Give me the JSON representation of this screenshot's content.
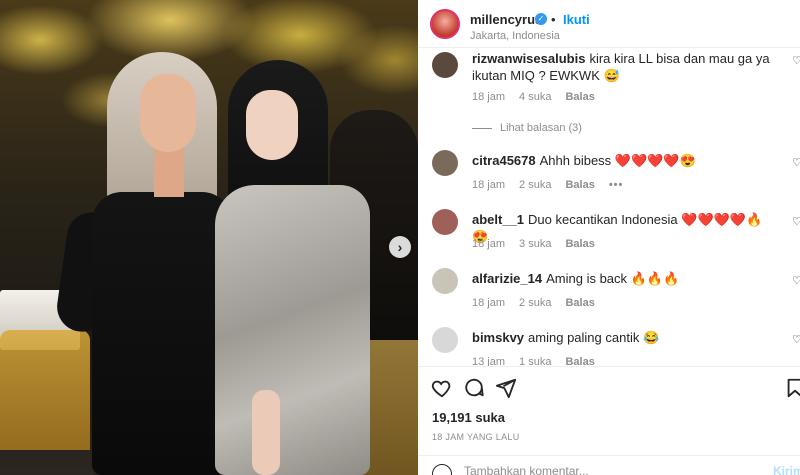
{
  "post": {
    "username": "millencyrus",
    "follow_label": "Ikuti",
    "dot": "•",
    "location": "Jakarta, Indonesia",
    "verified_icon": "verified-badge-icon",
    "next_icon": "chevron-right-icon"
  },
  "comments": [
    {
      "user": "rizwanwisesalubis",
      "text": "kira kira LL bisa dan mau ga ya ikutan MIQ ? EWKWK 😅",
      "time": "18 jam",
      "likes": "4 suka",
      "reply": "Balas",
      "avatar_color": "#5a4a3e"
    },
    {
      "user": "citra45678",
      "text": "Ahhh bibess ❤️❤️❤️❤️😍",
      "time": "18 jam",
      "likes": "2 suka",
      "reply": "Balas",
      "more": "•••",
      "avatar_color": "#7a6a5a"
    },
    {
      "user": "abelt__1",
      "text": "Duo kecantikan Indonesia ❤️❤️❤️❤️🔥😍",
      "time": "18 jam",
      "likes": "3 suka",
      "reply": "Balas",
      "avatar_color": "#a0605a"
    },
    {
      "user": "alfarizie_14",
      "text": "Aming is back 🔥🔥🔥",
      "time": "18 jam",
      "likes": "2 suka",
      "reply": "Balas",
      "avatar_color": "#c9c3b8"
    },
    {
      "user": "bimskvy",
      "text": "aming paling cantik 😂",
      "time": "13 jam",
      "likes": "1 suka",
      "reply": "Balas",
      "avatar_color": "#d8d8d8"
    }
  ],
  "view_replies": "Lihat balasan (3)",
  "likes_count": "19,191 suka",
  "time_ago": "18 JAM YANG LALU",
  "add_comment": {
    "placeholder": "Tambahkan komentar...",
    "post_label": "Kirim"
  },
  "icons": {
    "like": "heart-icon",
    "comment": "comment-icon",
    "share": "share-icon",
    "save": "bookmark-icon"
  }
}
